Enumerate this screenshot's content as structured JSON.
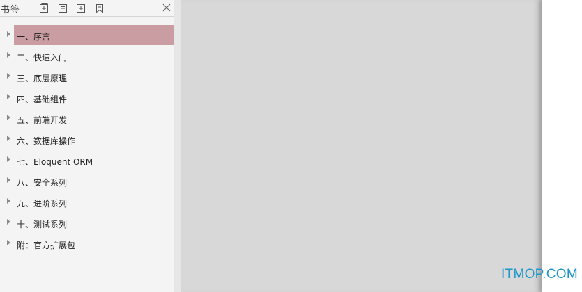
{
  "sidebar": {
    "title": "书签",
    "toolbar": {
      "icons": [
        "expand-all-icon",
        "collapse-all-icon",
        "add-bookmark-icon",
        "bookmark-icon"
      ],
      "close_icon": "close-icon"
    },
    "items": [
      {
        "label": "一、序言",
        "selected": true
      },
      {
        "label": "二、快速入门",
        "selected": false
      },
      {
        "label": "三、底层原理",
        "selected": false
      },
      {
        "label": "四、基础组件",
        "selected": false
      },
      {
        "label": "五、前端开发",
        "selected": false
      },
      {
        "label": "六、数据库操作",
        "selected": false
      },
      {
        "label": "七、Eloquent ORM",
        "selected": false
      },
      {
        "label": "八、安全系列",
        "selected": false
      },
      {
        "label": "九、进阶系列",
        "selected": false
      },
      {
        "label": "十、测试系列",
        "selected": false
      },
      {
        "label": "附：官方扩展包",
        "selected": false
      }
    ]
  },
  "watermark": "ITMOP.COM",
  "colors": {
    "selected_bg": "#c99da2",
    "watermark": "#1d98c9",
    "sidebar_bg": "#f4f4f4",
    "doc_bg": "#d8d8d8"
  }
}
